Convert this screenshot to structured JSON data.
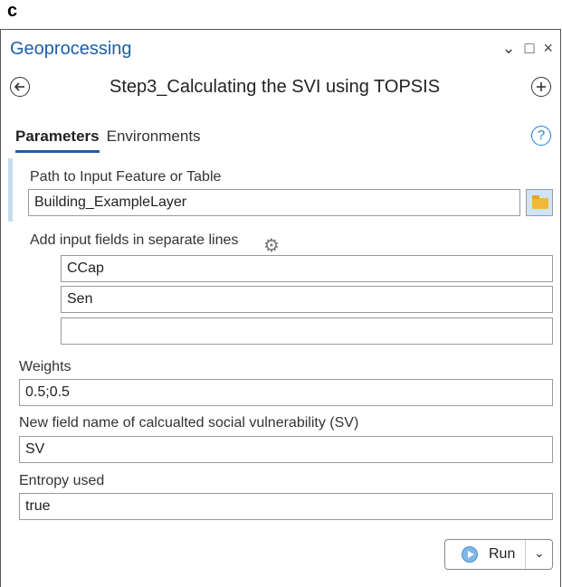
{
  "figure_label": "c",
  "window": {
    "title": "Geoprocessing",
    "controls": {
      "menu": "⌄",
      "maximize": "□",
      "close": "×"
    }
  },
  "tool": {
    "name": "Step3_Calculating the SVI using TOPSIS"
  },
  "tabs": [
    {
      "label": "Parameters",
      "active": true
    },
    {
      "label": "Environments",
      "active": false
    }
  ],
  "help": "?",
  "params": {
    "input_path": {
      "label": "Path to Input Feature or Table",
      "value": "Building_ExampleLayer"
    },
    "input_fields": {
      "label": "Add input fields in separate lines",
      "values": [
        "CCap",
        "Sen",
        ""
      ]
    },
    "weights": {
      "label": "Weights",
      "value": "0.5;0.5"
    },
    "new_field": {
      "label": "New field name of calcualted social vulnerability (SV)",
      "value": "SV"
    },
    "entropy": {
      "label": "Entropy used",
      "value": "true"
    }
  },
  "run": {
    "label": "Run"
  },
  "colors": {
    "accent": "#1d5fa6",
    "folder": "#f0b93b",
    "run_icon": "#7fb7e8"
  }
}
